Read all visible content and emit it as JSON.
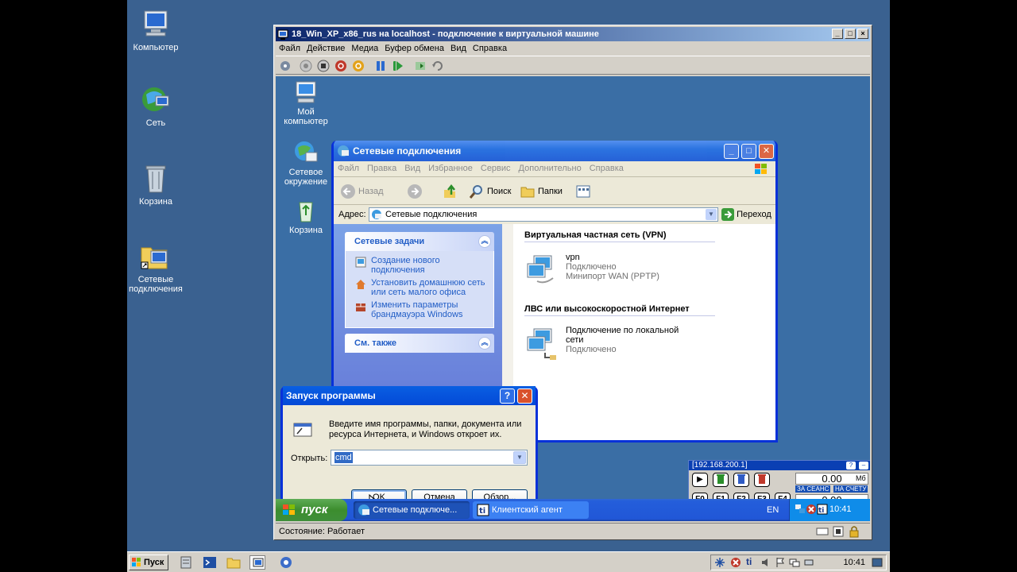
{
  "host": {
    "desktop_icons": [
      {
        "label": "Компьютер",
        "icon": "computer-icon"
      },
      {
        "label": "Сеть",
        "icon": "network-icon"
      },
      {
        "label": "Корзина",
        "icon": "recycle-bin-icon"
      },
      {
        "label": "Сетевые подключения",
        "icon": "network-connections-icon"
      }
    ],
    "taskbar": {
      "start_label": "Пуск",
      "clock": "10:41"
    }
  },
  "vm_window": {
    "title": "18_Win_XP_x86_rus на localhost - подключение к виртуальной машине",
    "menu": [
      "Файл",
      "Действие",
      "Медиа",
      "Буфер обмена",
      "Вид",
      "Справка"
    ],
    "status": "Состояние: Работает"
  },
  "guest": {
    "desktop_icons": [
      {
        "label": "Мой компьютер",
        "icon": "my-computer-icon"
      },
      {
        "label": "Сетевое окружение",
        "icon": "network-places-icon"
      },
      {
        "label": "Корзина",
        "icon": "recycle-bin-icon"
      }
    ],
    "net_window": {
      "title": "Сетевые подключения",
      "menu": [
        "Файл",
        "Правка",
        "Вид",
        "Избранное",
        "Сервис",
        "Дополнительно",
        "Справка"
      ],
      "toolbar": {
        "back": "Назад",
        "search": "Поиск",
        "folders": "Папки"
      },
      "address_label": "Адрес:",
      "address_value": "Сетевые подключения",
      "go_label": "Переход",
      "tasks_title": "Сетевые задачи",
      "tasks": [
        "Создание нового подключения",
        "Установить домашнюю сеть или сеть малого офиса",
        "Изменить параметры брандмауэра Windows"
      ],
      "see_also_title": "См. также",
      "groups": [
        {
          "title": "Виртуальная частная сеть (VPN)",
          "items": [
            {
              "name": "vpn",
              "status": "Подключено",
              "device": "Минипорт WAN (PPTP)"
            }
          ]
        },
        {
          "title": "ЛВС или высокоскоростной Интернет",
          "items": [
            {
              "name": "Подключение по локальной сети",
              "status": "Подключено"
            }
          ]
        }
      ]
    },
    "run_dialog": {
      "title": "Запуск программы",
      "help": "?",
      "description": "Введите имя программы, папки, документа или ресурса Интернета, и Windows откроет их.",
      "open_label": "Открыть:",
      "open_value": "cmd",
      "ok": "OK",
      "cancel": "Отмена",
      "browse": "Обзор..."
    },
    "taskbar": {
      "start_label": "пуск",
      "tasks": [
        {
          "label": "Сетевые подключе...",
          "active": true
        },
        {
          "label": "Клиентский агент",
          "active": false
        }
      ],
      "language": "EN",
      "clock": "10:41"
    },
    "agent": {
      "ip": "[192.168.200.1]",
      "top_value": "0.00",
      "unit": "Мб",
      "session_tag": "ЗА СЕАНС",
      "account_tag": "НА СЧЕТУ",
      "bottom_value": "0.00",
      "fkeys": [
        "F0",
        "F1",
        "F2",
        "F3",
        "F4"
      ]
    }
  },
  "colors": {
    "host_desktop": "#3a6190",
    "guest_desktop": "#3a6ea5",
    "xp_title": "#0349d7",
    "xp_start": "#3c8d2e"
  }
}
